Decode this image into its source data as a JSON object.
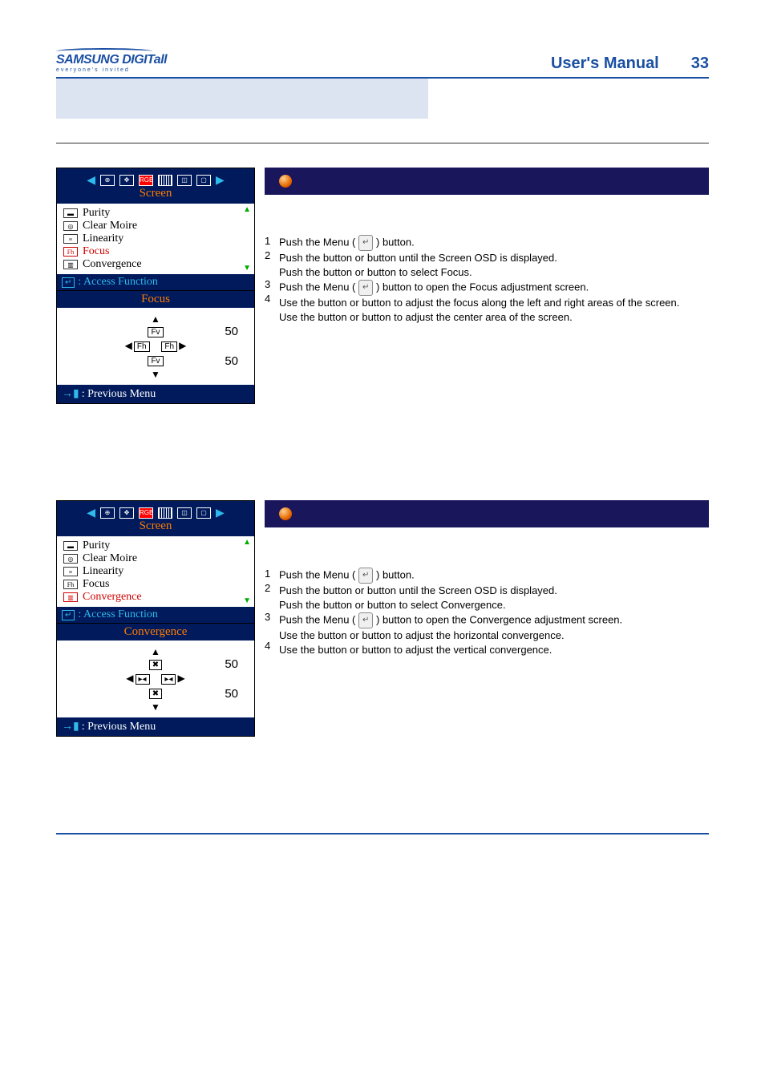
{
  "header": {
    "logo_main": "SAMSUNG DIGIT",
    "logo_suffix": "all",
    "logo_tagline": "everyone's invited",
    "manual_title": "User's Manual",
    "page_number": "33"
  },
  "osd_common": {
    "screen_label": "Screen",
    "menu_items": [
      "Purity",
      "Clear Moire",
      "Linearity",
      "Focus",
      "Convergence"
    ],
    "access_label": ": Access Function",
    "prev_label": " : Previous Menu"
  },
  "osd_focus": {
    "selected_index": 3,
    "sub_title": "Focus",
    "val1": "50",
    "val2": "50"
  },
  "osd_conv": {
    "selected_index": 4,
    "sub_title": "Convergence",
    "val1": "50",
    "val2": "50"
  },
  "focus": {
    "steps": {
      "n1": "1",
      "n2": "2",
      "n3": "3",
      "n4": "4",
      "s1a": "Push the Menu ( ",
      "s1b": " ) button.",
      "s2a": "Push the     button or      button until the Screen OSD is displayed.",
      "s2b": "Push the     button or       button to select Focus.",
      "s3a": "Push the Menu ( ",
      "s3b": " ) button to open the Focus adjustment screen.",
      "s4a": "Use the     button or      button to adjust the focus along the left and right areas of the screen.",
      "s4b": "Use the     button or      button to adjust the center area of the screen."
    }
  },
  "conv": {
    "steps": {
      "n1": "1",
      "n2": "2",
      "n3": "3",
      "n4": "4",
      "s1a": "Push the Menu ( ",
      "s1b": " ) button.",
      "s2a": "Push the     button or      button until the Screen OSD is displayed.",
      "s2b": "Push the     button or       button to select Convergence.",
      "s3a": "Push the Menu ( ",
      "s3b": " ) button to open the Convergence adjustment screen.",
      "s4a": "Use the     button or      button to adjust the horizontal convergence.",
      "s4b": "Use the     button or      button to adjust the vertical convergence."
    }
  }
}
